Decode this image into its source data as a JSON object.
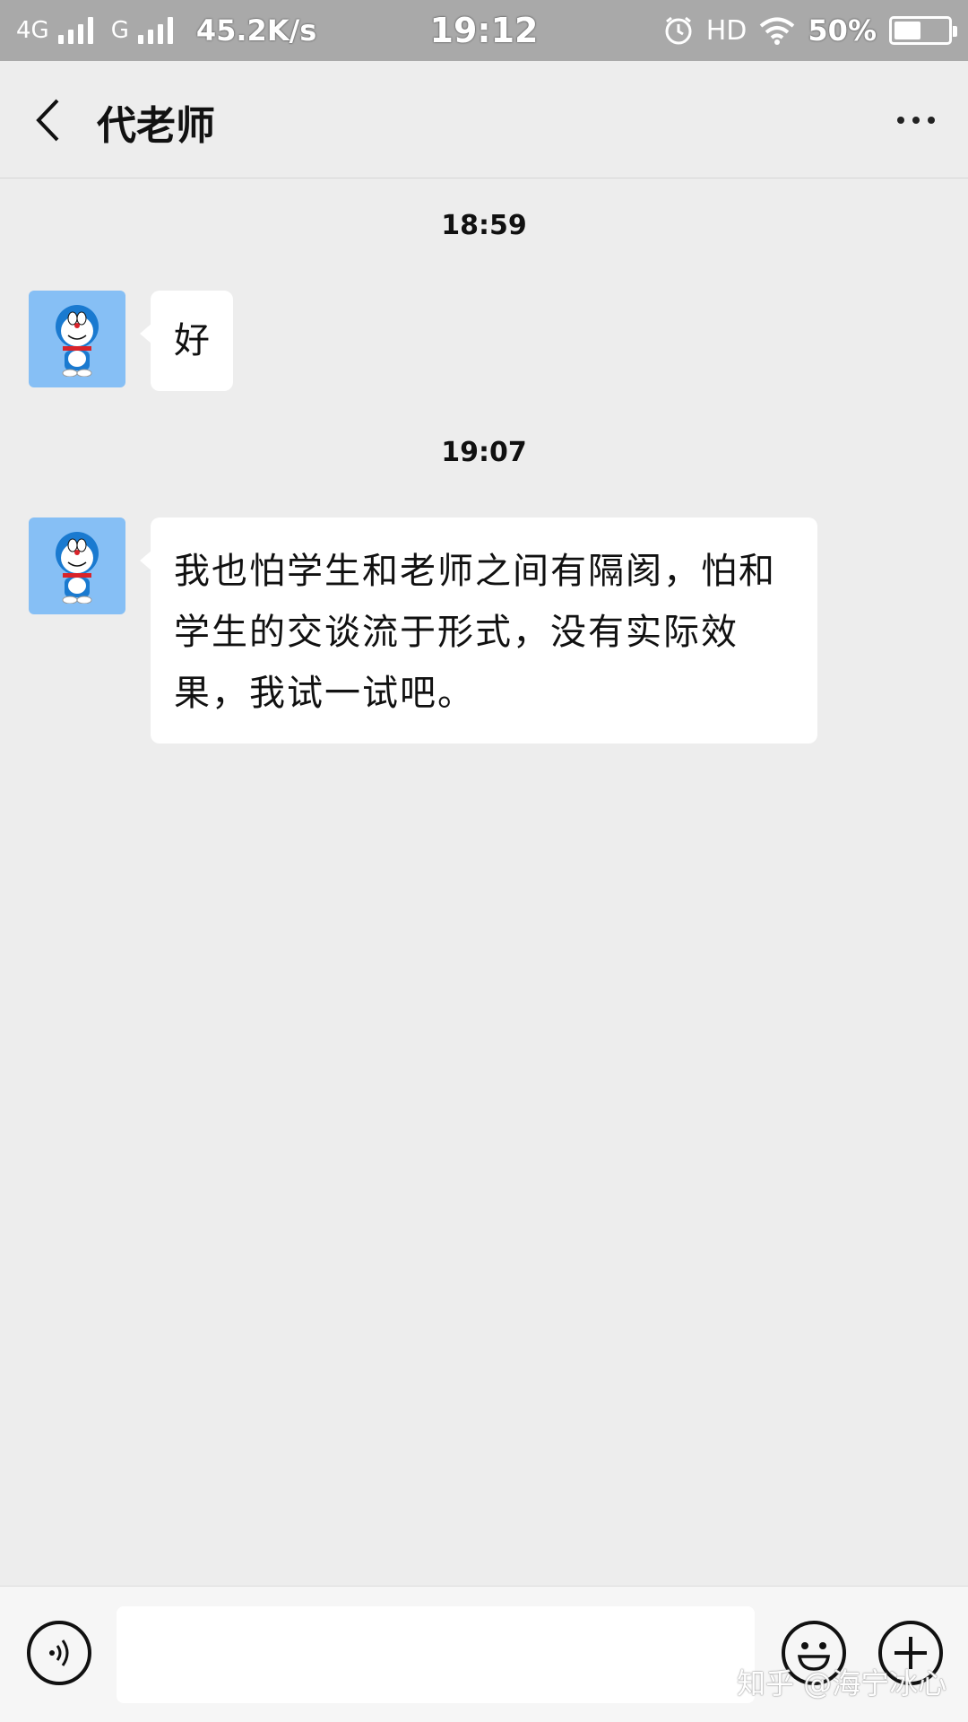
{
  "status_bar": {
    "network_1": "4G",
    "network_2": "G",
    "speed": "45.2K/s",
    "time": "19:12",
    "hd": "HD",
    "battery": "50%",
    "battery_level": 0.5,
    "icons": [
      "signal-icon",
      "alarm-icon",
      "wifi-icon",
      "battery-icon"
    ]
  },
  "header": {
    "title": "代老师",
    "back_icon": "chevron-left-icon",
    "more_icon": "more-dots-icon"
  },
  "messages": [
    {
      "timestamp": "18:59",
      "sender": "contact",
      "text": "好"
    },
    {
      "timestamp": "19:07",
      "sender": "contact",
      "text": "我也怕学生和老师之间有隔阂，怕和学生的交谈流于形式，没有实际效果，我试一试吧。"
    }
  ],
  "input_bar": {
    "value": "",
    "voice_icon": "voice-icon",
    "emoji_icon": "emoji-icon",
    "plus_icon": "plus-icon"
  },
  "watermark": "知乎 @海宁冰心",
  "colors": {
    "status_bar_bg": "#a9a9a9",
    "chat_bg": "#ededed",
    "bubble_bg": "#ffffff",
    "avatar_bg": "#86bff5"
  }
}
